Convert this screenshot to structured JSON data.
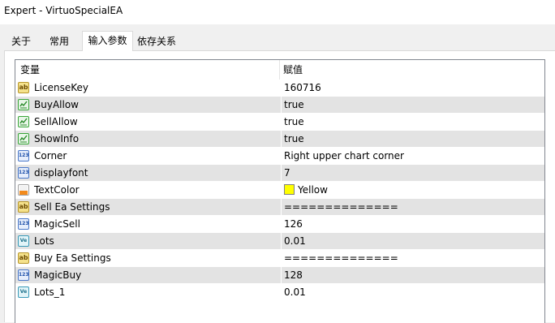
{
  "window": {
    "title": "Expert - VirtuoSpecialEA"
  },
  "tabs": [
    {
      "label": "关于",
      "active": false
    },
    {
      "label": "常用",
      "active": false
    },
    {
      "label": "输入参数",
      "active": true
    },
    {
      "label": "依存关系",
      "active": false
    }
  ],
  "table": {
    "columns": [
      "变量",
      "赋值"
    ],
    "rows": [
      {
        "icon": "string-type-icon",
        "name": "LicenseKey",
        "value": "160716"
      },
      {
        "icon": "bool-type-icon",
        "name": "BuyAllow",
        "value": "true"
      },
      {
        "icon": "bool-type-icon",
        "name": "SellAllow",
        "value": "true"
      },
      {
        "icon": "bool-type-icon",
        "name": "ShowInfo",
        "value": "true"
      },
      {
        "icon": "int-type-icon",
        "name": "Corner",
        "value": "Right upper chart corner"
      },
      {
        "icon": "int-type-icon",
        "name": "displayfont",
        "value": "7"
      },
      {
        "icon": "color-type-icon",
        "name": "TextColor",
        "value": "Yellow",
        "swatch": "#ffff00"
      },
      {
        "icon": "string-type-icon",
        "name": "Sell Ea Settings",
        "value": "=============="
      },
      {
        "icon": "int-type-icon",
        "name": "MagicSell",
        "value": "126"
      },
      {
        "icon": "double-type-icon",
        "name": "Lots",
        "value": "0.01"
      },
      {
        "icon": "string-type-icon",
        "name": "Buy Ea Settings",
        "value": "=============="
      },
      {
        "icon": "int-type-icon",
        "name": "MagicBuy",
        "value": "128"
      },
      {
        "icon": "double-type-icon",
        "name": "Lots_1",
        "value": "0.01"
      }
    ]
  },
  "icon_glyphs": {
    "string-type-icon": "ab",
    "int-type-icon": "123",
    "double-type-icon": "Ve"
  },
  "colors": {
    "row_alt": "#e3e3e3",
    "grid_border": "#828790",
    "swatch_yellow": "#ffff00"
  }
}
